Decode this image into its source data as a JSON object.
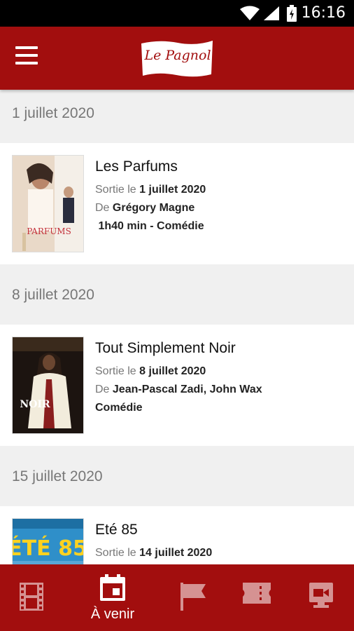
{
  "status_bar": {
    "time": "16:16"
  },
  "app": {
    "logo_text": "Le Pagnol"
  },
  "sections": [
    {
      "date": "1 juillet 2020",
      "movie": {
        "title": "Les Parfums",
        "release_label": "Sortie le",
        "release_date": "1 juillet 2020",
        "director_label": "De",
        "directors": "Grégory Magne",
        "details": " 1h40 min - Comédie"
      }
    },
    {
      "date": "8 juillet 2020",
      "movie": {
        "title": "Tout Simplement Noir",
        "release_label": "Sortie le",
        "release_date": "8 juillet 2020",
        "director_label": "De",
        "directors": "Jean-Pascal Zadi, John Wax",
        "details": "Comédie"
      }
    },
    {
      "date": "15 juillet 2020",
      "movie": {
        "title": "Eté 85",
        "release_label": "Sortie le",
        "release_date": "14 juillet 2020"
      }
    }
  ],
  "bottom_nav": {
    "items": [
      {
        "icon": "film-icon"
      },
      {
        "icon": "calendar-icon",
        "label": "À venir",
        "active": true
      },
      {
        "icon": "flag-icon"
      },
      {
        "icon": "ticket-icon"
      },
      {
        "icon": "video-camera-icon"
      }
    ]
  },
  "colors": {
    "primary": "#a20e0e",
    "header_bg": "#f0f0f0",
    "muted_text": "#777777"
  }
}
